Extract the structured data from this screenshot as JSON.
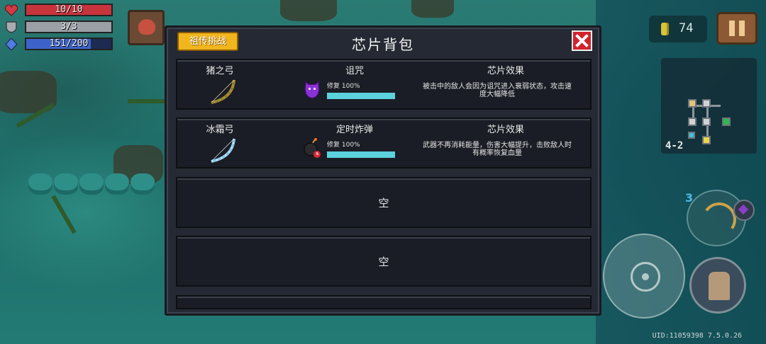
{
  "hud": {
    "hp": "10/10",
    "hp_fraction": 1.0,
    "armor": "3/3",
    "armor_fraction": 1.0,
    "energy": "151/200",
    "energy_fraction": 0.755,
    "coins": "74",
    "level": "4-2",
    "weapon_energy_cost": "3",
    "uid": "UID:11059398 7.5.0.26"
  },
  "modal": {
    "title": "芯片背包",
    "tab_label": "祖传挑战",
    "slots": [
      {
        "weapon": "猪之弓",
        "chip_name": "诅咒",
        "repair": "修复 100%",
        "repair_fraction": 1.0,
        "effect_title": "芯片效果",
        "effect_text": "被击中的敌人会因为诅咒进入衰弱状态，攻击速度大幅降低"
      },
      {
        "weapon": "冰霜弓",
        "chip_name": "定时炸弹",
        "repair": "修复 100%",
        "repair_fraction": 1.0,
        "effect_title": "芯片效果",
        "effect_text": "武器不再消耗能量，伤害大幅提升，击败敌人时有概率恢复血量"
      },
      {
        "empty_label": "空"
      },
      {
        "empty_label": "空"
      }
    ]
  },
  "colors": {
    "hp": "#c8343c",
    "armor": "#9aa0a6",
    "energy": "#3d63c9",
    "tab": "#f1b51d",
    "close": "#d2222d",
    "progress": "#5bd2dd"
  }
}
